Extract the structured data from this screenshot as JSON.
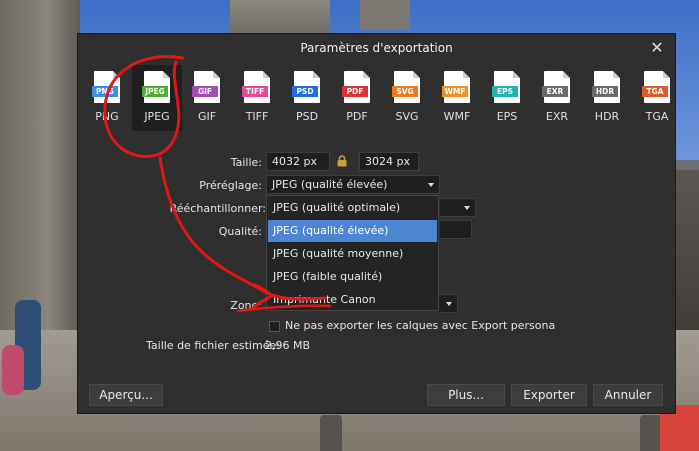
{
  "dialog": {
    "title": "Paramètres d'exportation",
    "close_symbol": "✕"
  },
  "formats": [
    {
      "label": "PNG",
      "badge": "PNG",
      "color": "#3d8ee6"
    },
    {
      "label": "JPEG",
      "badge": "JPEG",
      "color": "#4caf32"
    },
    {
      "label": "GIF",
      "badge": "GIF",
      "color": "#a54bb6"
    },
    {
      "label": "TIFF",
      "badge": "TIFF",
      "color": "#e9479a"
    },
    {
      "label": "PSD",
      "badge": "PSD",
      "color": "#1f6de0"
    },
    {
      "label": "PDF",
      "badge": "PDF",
      "color": "#e03232"
    },
    {
      "label": "SVG",
      "badge": "SVG",
      "color": "#f07a1e"
    },
    {
      "label": "WMF",
      "badge": "WMF",
      "color": "#f08f2a"
    },
    {
      "label": "EPS",
      "badge": "EPS",
      "color": "#1fb3b3"
    },
    {
      "label": "EXR",
      "badge": "EXR",
      "color": "#6a6a6a"
    },
    {
      "label": "HDR",
      "badge": "HDR",
      "color": "#6a6a6a"
    },
    {
      "label": "TGA",
      "badge": "TGA",
      "color": "#e05a2a"
    }
  ],
  "selected_format": "JPEG",
  "size": {
    "label": "Taille:",
    "width": "4032 px",
    "height": "3024 px"
  },
  "preset": {
    "label": "Préréglage:",
    "value": "JPEG (qualité élevée)",
    "options": [
      "JPEG (qualité optimale)",
      "JPEG (qualité élevée)",
      "JPEG (qualité moyenne)",
      "JPEG (faible qualité)",
      "Imprimante Canon"
    ],
    "highlighted": "JPEG (qualité élevée)"
  },
  "resample": {
    "label": "Rééchantillonner:"
  },
  "quality": {
    "label": "Qualité:"
  },
  "zone": {
    "label": "Zone:"
  },
  "no_export_layers": "Ne pas exporter les calques avec Export persona",
  "filesize": {
    "label": "Taille de fichier estimée:",
    "value": "2,96 MB"
  },
  "buttons": {
    "preview": "Aperçu...",
    "more": "Plus...",
    "export": "Exporter",
    "cancel": "Annuler"
  },
  "colors": {
    "highlight": "#4c85d1",
    "dialog_bg": "#2f2f2f",
    "annotation": "#e01818"
  }
}
